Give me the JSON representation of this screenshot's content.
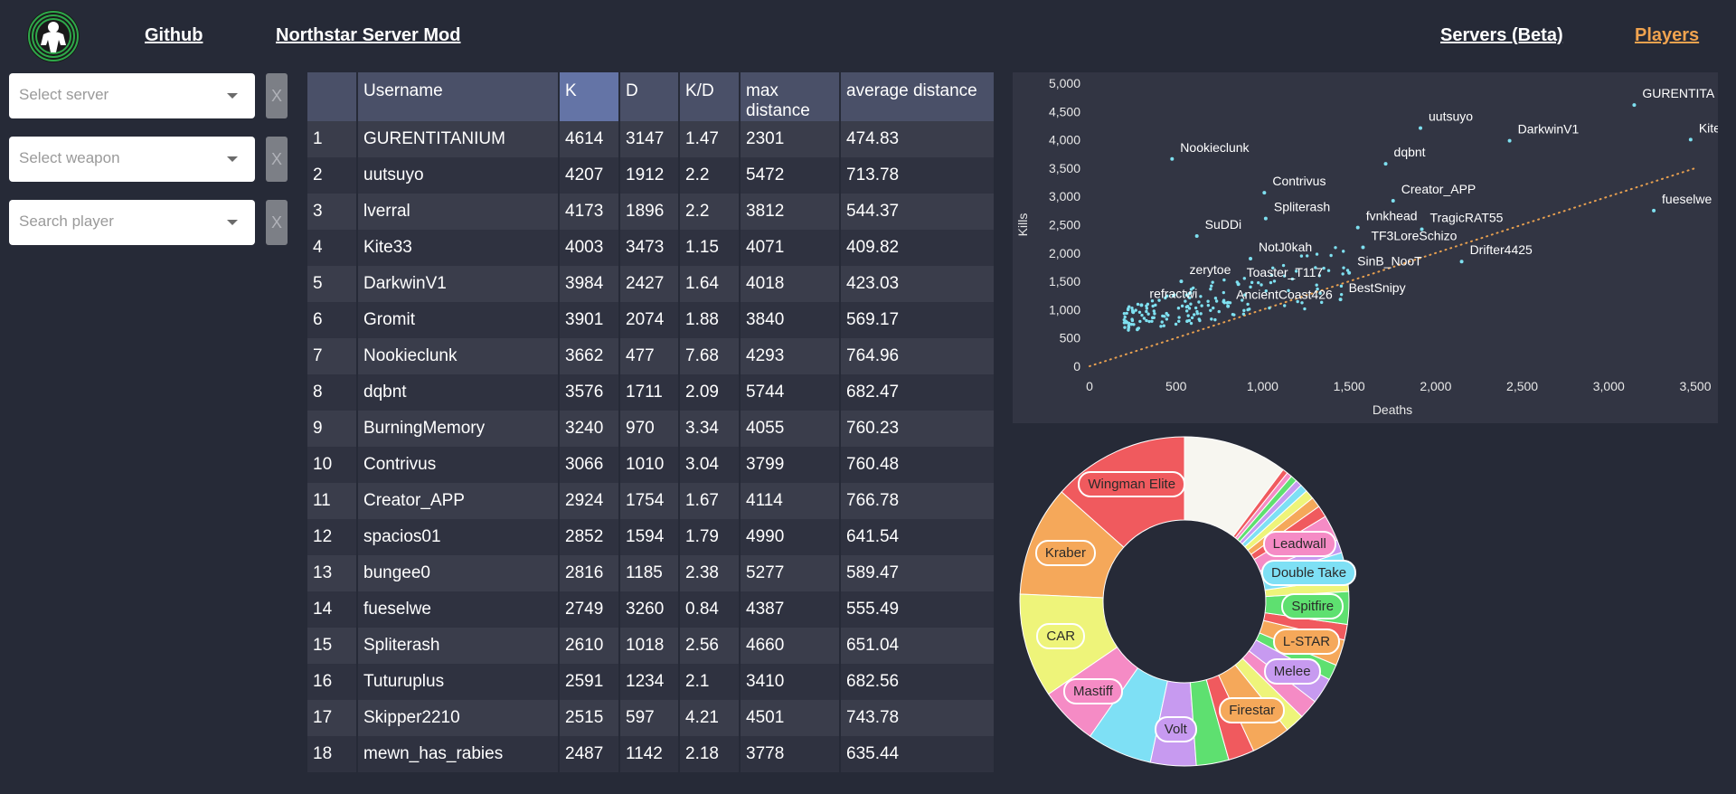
{
  "header": {
    "github": "Github",
    "mod": "Northstar Server Mod",
    "servers": "Servers (Beta)",
    "players": "Players",
    "players_color": "#f0a34f"
  },
  "filters": {
    "server": {
      "placeholder": "Select server",
      "clear": "X"
    },
    "weapon": {
      "placeholder": "Select weapon",
      "clear": "X"
    },
    "player": {
      "placeholder": "Search player",
      "clear": "X"
    }
  },
  "table": {
    "columns": [
      "",
      "Username",
      "K",
      "D",
      "K/D",
      "max distance",
      "average distance"
    ],
    "sorted_column": "K",
    "rows": [
      [
        "1",
        "GURENTITANIUM",
        "4614",
        "3147",
        "1.47",
        "2301",
        "474.83"
      ],
      [
        "2",
        "uutsuyo",
        "4207",
        "1912",
        "2.2",
        "5472",
        "713.78"
      ],
      [
        "3",
        "lverral",
        "4173",
        "1896",
        "2.2",
        "3812",
        "544.37"
      ],
      [
        "4",
        "Kite33",
        "4003",
        "3473",
        "1.15",
        "4071",
        "409.82"
      ],
      [
        "5",
        "DarkwinV1",
        "3984",
        "2427",
        "1.64",
        "4018",
        "423.03"
      ],
      [
        "6",
        "Gromit",
        "3901",
        "2074",
        "1.88",
        "3840",
        "569.17"
      ],
      [
        "7",
        "Nookieclunk",
        "3662",
        "477",
        "7.68",
        "4293",
        "764.96"
      ],
      [
        "8",
        "dqbnt",
        "3576",
        "1711",
        "2.09",
        "5744",
        "682.47"
      ],
      [
        "9",
        "BurningMemory",
        "3240",
        "970",
        "3.34",
        "4055",
        "760.23"
      ],
      [
        "10",
        "Contrivus",
        "3066",
        "1010",
        "3.04",
        "3799",
        "760.48"
      ],
      [
        "11",
        "Creator_APP",
        "2924",
        "1754",
        "1.67",
        "4114",
        "766.78"
      ],
      [
        "12",
        "spacios01",
        "2852",
        "1594",
        "1.79",
        "4990",
        "641.54"
      ],
      [
        "13",
        "bungee0",
        "2816",
        "1185",
        "2.38",
        "5277",
        "589.47"
      ],
      [
        "14",
        "fueselwe",
        "2749",
        "3260",
        "0.84",
        "4387",
        "555.49"
      ],
      [
        "15",
        "Spliterash",
        "2610",
        "1018",
        "2.56",
        "4660",
        "651.04"
      ],
      [
        "16",
        "Tuturuplus",
        "2591",
        "1234",
        "2.1",
        "3410",
        "682.56"
      ],
      [
        "17",
        "Skipper2210",
        "2515",
        "597",
        "4.21",
        "4501",
        "743.78"
      ],
      [
        "18",
        "mewn_has_rabies",
        "2487",
        "1142",
        "2.18",
        "3778",
        "635.44"
      ]
    ]
  },
  "scatter": {
    "xlabel": "Deaths",
    "ylabel": "Kills",
    "xlim": [
      0,
      3500
    ],
    "ylim": [
      0,
      5000
    ],
    "xticks": [
      "0",
      "500",
      "1,000",
      "1,500",
      "2,000",
      "2,500",
      "3,000",
      "3,500"
    ],
    "yticks": [
      "0",
      "500",
      "1,000",
      "1,500",
      "2,000",
      "2,500",
      "3,000",
      "3,500",
      "4,000",
      "4,500",
      "5,000"
    ],
    "point_color": "#7ee0f0",
    "trend_color": "#e8a050",
    "labels": [
      {
        "text": "GURENTITA",
        "x": 3147,
        "y": 4614
      },
      {
        "text": "uutsuyo",
        "x": 1912,
        "y": 4207
      },
      {
        "text": "DarkwinV1",
        "x": 2427,
        "y": 3984
      },
      {
        "text": "Kite",
        "x": 3473,
        "y": 4003
      },
      {
        "text": "Nookieclunk",
        "x": 477,
        "y": 3662
      },
      {
        "text": "dqbnt",
        "x": 1711,
        "y": 3576
      },
      {
        "text": "Contrivus",
        "x": 1010,
        "y": 3066
      },
      {
        "text": "Creator_APP",
        "x": 1754,
        "y": 2924
      },
      {
        "text": "Spliterash",
        "x": 1018,
        "y": 2610
      },
      {
        "text": "fvnkhead",
        "x": 1550,
        "y": 2450
      },
      {
        "text": "TragicRAT55",
        "x": 1920,
        "y": 2420
      },
      {
        "text": "fueselwe",
        "x": 3260,
        "y": 2749
      },
      {
        "text": "SuDDi",
        "x": 620,
        "y": 2300
      },
      {
        "text": "TF3LoreSchizo",
        "x": 1580,
        "y": 2100
      },
      {
        "text": "NotJ0kah",
        "x": 930,
        "y": 1900
      },
      {
        "text": "Drifter4425",
        "x": 2150,
        "y": 1850
      },
      {
        "text": "SinB_NooT",
        "x": 1500,
        "y": 1650
      },
      {
        "text": "zerytoe",
        "x": 530,
        "y": 1500
      },
      {
        "text": "Toaster_T117",
        "x": 860,
        "y": 1450
      },
      {
        "text": "BestSnipy",
        "x": 1450,
        "y": 1180
      },
      {
        "text": "refractwi",
        "x": 300,
        "y": 1080
      },
      {
        "text": "AncientCoast426",
        "x": 800,
        "y": 1060
      }
    ]
  },
  "weapons": {
    "items": [
      {
        "label": "Wingman Elite",
        "share": 10.5,
        "color": "#f05a5e"
      },
      {
        "label": "Kraber",
        "share": 8.5,
        "color": "#f5a85a"
      },
      {
        "label": "CAR",
        "share": 8.0,
        "color": "#eef47a"
      },
      {
        "label": "Mastiff",
        "share": 4.5,
        "color": "#f58bc5"
      },
      {
        "label": "",
        "share": 5.0,
        "color": "#7ee0f5"
      },
      {
        "label": "Volt",
        "share": 3.5,
        "color": "#c79af0"
      },
      {
        "label": "",
        "share": 2.5,
        "color": "#5ee070"
      },
      {
        "label": "",
        "share": 2.0,
        "color": "#f05a5e"
      },
      {
        "label": "Firestar",
        "share": 3.0,
        "color": "#f5a85a"
      },
      {
        "label": "",
        "share": 1.5,
        "color": "#eef47a"
      },
      {
        "label": "",
        "share": 1.5,
        "color": "#f58bc5"
      },
      {
        "label": "Melee",
        "share": 2.0,
        "color": "#c79af0"
      },
      {
        "label": "",
        "share": 1.2,
        "color": "#5ee070"
      },
      {
        "label": "L-STAR",
        "share": 2.0,
        "color": "#f5a85a"
      },
      {
        "label": "",
        "share": 1.2,
        "color": "#f05a5e"
      },
      {
        "label": "Spitfire",
        "share": 2.5,
        "color": "#5ee070"
      },
      {
        "label": "",
        "share": 1.0,
        "color": "#eef47a"
      },
      {
        "label": "Double Take",
        "share": 2.0,
        "color": "#7ee0f5"
      },
      {
        "label": "",
        "share": 1.0,
        "color": "#c79af0"
      },
      {
        "label": "Leadwall",
        "share": 2.0,
        "color": "#f58bc5"
      },
      {
        "label": "",
        "share": 0.9,
        "color": "#f05a5e"
      },
      {
        "label": "",
        "share": 0.8,
        "color": "#f5a85a"
      },
      {
        "label": "",
        "share": 0.7,
        "color": "#eef47a"
      },
      {
        "label": "",
        "share": 0.6,
        "color": "#7ee0f5"
      },
      {
        "label": "",
        "share": 0.5,
        "color": "#c79af0"
      },
      {
        "label": "",
        "share": 0.5,
        "color": "#5ee070"
      },
      {
        "label": "",
        "share": 0.4,
        "color": "#f58bc5"
      },
      {
        "label": "",
        "share": 0.4,
        "color": "#f05a5e"
      },
      {
        "label": "",
        "share": 8.0,
        "color": "#f7f6f0"
      }
    ]
  }
}
